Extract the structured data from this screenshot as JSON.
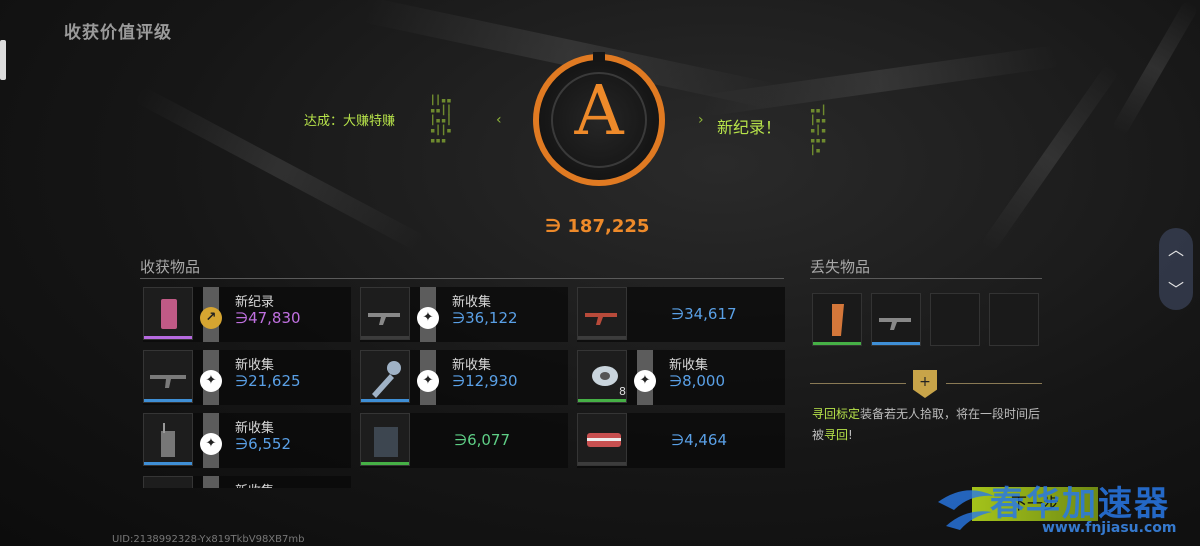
{
  "page_title": "收获价值评级",
  "rating": {
    "grade": "A",
    "achievement": "达成：大赚特赚",
    "new_record": "新纪录！",
    "total_value": "∋ 187,225",
    "accent_color": "#ee8a2a"
  },
  "harvest": {
    "title": "收获物品",
    "items": [
      {
        "tag": "新纪录",
        "value": "∋47,830",
        "value_color": "#c070e0",
        "rarity_color": "#b66ae0",
        "badge": "gold",
        "icon": "card-icon"
      },
      {
        "tag": "新收集",
        "value": "∋36,122",
        "value_color": "#5aa0e6",
        "rarity_color": "#3c3c3c",
        "badge": "white",
        "icon": "rifle-icon"
      },
      {
        "tag": "",
        "value": "∋34,617",
        "value_color": "#5aa0e6",
        "rarity_color": "#3c3c3c",
        "badge": "none",
        "icon": "red-rifle-icon"
      },
      {
        "tag": "新收集",
        "value": "∋21,625",
        "value_color": "#5aa0e6",
        "rarity_color": "#3f8fd6",
        "badge": "white",
        "icon": "ak-rifle-icon"
      },
      {
        "tag": "新收集",
        "value": "∋12,930",
        "value_color": "#5aa0e6",
        "rarity_color": "#3f8fd6",
        "badge": "white",
        "icon": "key-icon"
      },
      {
        "tag": "新收集",
        "value": "∋8,000",
        "value_color": "#5aa0e6",
        "rarity_color": "#46b046",
        "badge": "white",
        "icon": "tape-roll-icon",
        "qty": "8"
      },
      {
        "tag": "新收集",
        "value": "∋6,552",
        "value_color": "#5aa0e6",
        "rarity_color": "#3f8fd6",
        "badge": "white",
        "icon": "radio-icon"
      },
      {
        "tag": "",
        "value": "∋6,077",
        "value_color": "#5fcf86",
        "rarity_color": "#46b046",
        "badge": "none",
        "icon": "vest-icon"
      },
      {
        "tag": "",
        "value": "∋4,464",
        "value_color": "#5aa0e6",
        "rarity_color": "#3c3c3c",
        "badge": "none",
        "icon": "bandage-icon"
      },
      {
        "tag": "新收集",
        "value": "",
        "value_color": "#5aa0e6",
        "rarity_color": "#3c3c3c",
        "badge": "white",
        "icon": "item-icon"
      }
    ]
  },
  "lost": {
    "title": "丢失物品",
    "items": [
      {
        "icon": "magazine-icon",
        "rarity_color": "#46b046"
      },
      {
        "icon": "rifle-icon",
        "rarity_color": "#3f8fd6"
      },
      {
        "icon": "empty-slot",
        "rarity_color": ""
      },
      {
        "icon": "empty-slot",
        "rarity_color": ""
      }
    ],
    "hint_highlight": "寻回标定",
    "hint_text": "装备若无人拾取，将在一段时间后被",
    "hint_highlight2": "寻回",
    "hint_end": "!"
  },
  "next_button": "下一步",
  "uid": "UID:2138992328-Yx819TkbV98XB7mb",
  "watermark": {
    "big": "春华加速器",
    "small": "www.fnjiasu.com"
  }
}
